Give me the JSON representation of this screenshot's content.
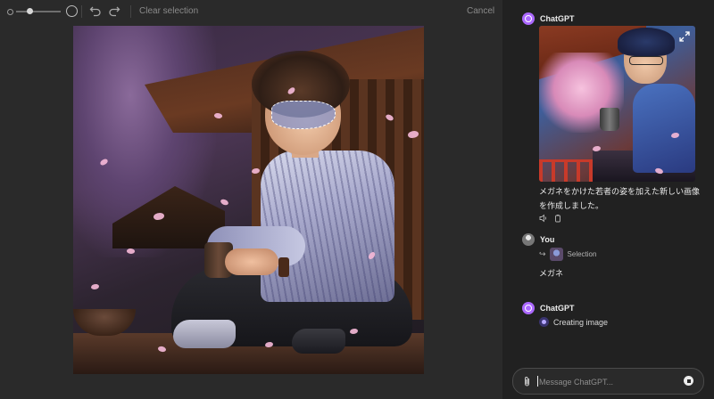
{
  "editor": {
    "toolbar": {
      "clear_selection_label": "Clear selection",
      "cancel_label": "Cancel",
      "brush_size_level": 0.3,
      "icons": [
        "small-brush-icon",
        "large-brush-icon",
        "undo-icon",
        "redo-icon"
      ]
    },
    "canvas": {
      "petal_color": "#f3b7d6",
      "selection_fill": "#8c96c8"
    }
  },
  "chat": {
    "messages": [
      {
        "sender": "ChatGPT",
        "avatar": "chatgpt-logo-icon",
        "text": "メガネをかけた若者の姿を加えた新しい画像を作成しました。",
        "actions": [
          "speaker-icon",
          "copy-icon"
        ]
      },
      {
        "sender": "You",
        "avatar": "user-avatar",
        "selection_label": "Selection",
        "text": "メガネ"
      },
      {
        "sender": "ChatGPT",
        "avatar": "chatgpt-logo-icon",
        "status_text": "Creating image"
      }
    ],
    "composer": {
      "placeholder": "Message ChatGPT...",
      "value": ""
    },
    "colors": {
      "accent": "#ab68ff",
      "background": "#212121",
      "editor_background": "#2a2a2a"
    }
  }
}
